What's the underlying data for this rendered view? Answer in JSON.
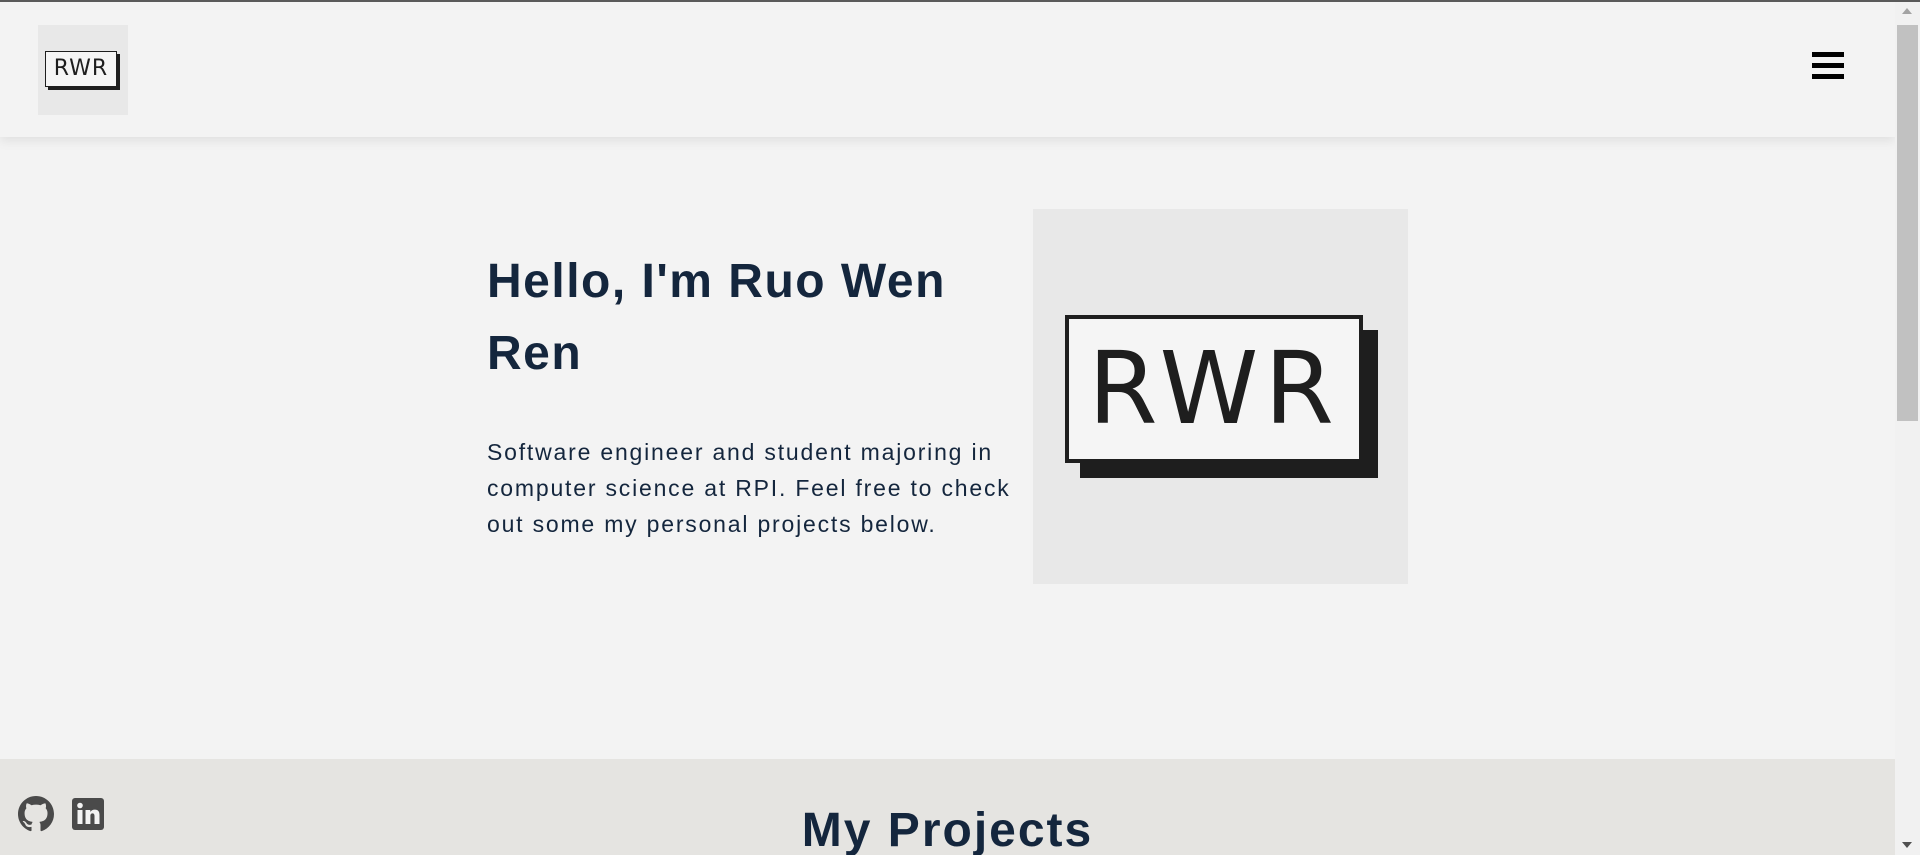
{
  "header": {
    "logo_text": "RWR",
    "menu_icon": "hamburger-menu-icon"
  },
  "hero": {
    "title": "Hello, I'm Ruo Wen Ren",
    "description": "Software engineer and student majoring in computer science at RPI. Feel free to check out some my personal projects below.",
    "image_logo_text": "RWR"
  },
  "projects": {
    "title": "My Projects"
  },
  "social": {
    "github_icon": "github-icon",
    "linkedin_icon": "linkedin-icon"
  },
  "colors": {
    "background": "#f3f3f3",
    "heading": "#14263d",
    "projects_background": "#e5e4e1",
    "logo_dark": "#1e1e1e",
    "icon_gray": "#4a4a4a"
  }
}
